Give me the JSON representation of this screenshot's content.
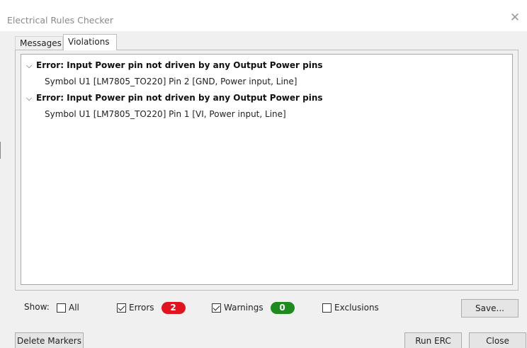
{
  "window": {
    "title": "Electrical Rules Checker",
    "close_icon": "close-icon"
  },
  "tabs": [
    {
      "label": "Messages",
      "active": false
    },
    {
      "label": "Violations",
      "active": true
    }
  ],
  "violations": [
    {
      "expanded": true,
      "error": "Error: Input Power pin not driven by any Output Power pins",
      "item": "Symbol U1 [LM7805_TO220] Pin 2 [GND, Power input, Line]"
    },
    {
      "expanded": true,
      "error": "Error: Input Power pin not driven by any Output Power pins",
      "item": "Symbol U1 [LM7805_TO220] Pin 1 [VI, Power input, Line]"
    }
  ],
  "filters": {
    "show_label": "Show:",
    "all": {
      "label": "All",
      "checked": false
    },
    "errors": {
      "label": "Errors",
      "checked": true,
      "count": "2",
      "badge_color": "#e0141e"
    },
    "warnings": {
      "label": "Warnings",
      "checked": true,
      "count": "0",
      "badge_color": "#1f8a1f"
    },
    "exclusions": {
      "label": "Exclusions",
      "checked": false
    }
  },
  "buttons": {
    "save": "Save...",
    "delete_markers": "Delete Markers",
    "run_erc": "Run ERC",
    "close": "Close"
  }
}
